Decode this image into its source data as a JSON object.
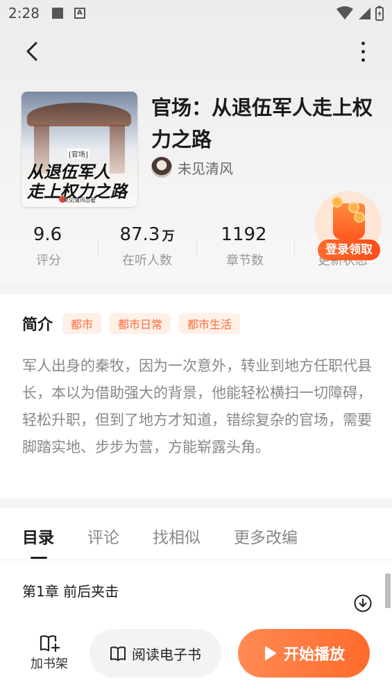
{
  "status_bar": {
    "time": "2:28"
  },
  "book": {
    "title": "官场：从退伍军人走上权力之路",
    "author": "未见清风",
    "cover": {
      "tag": "[官场]",
      "line1": "从退伍军人",
      "line2": "走上权力之路",
      "author_mark": "未见清风◎著"
    }
  },
  "stats": [
    {
      "value": "9.6",
      "unit": "",
      "label": "评分"
    },
    {
      "value": "87.3",
      "unit": "万",
      "label": "在听人数"
    },
    {
      "value": "1192",
      "unit": "",
      "label": "章节数"
    },
    {
      "value": "",
      "unit": "",
      "label": "更新状态"
    }
  ],
  "promo": {
    "label": "登录领取"
  },
  "intro": {
    "heading": "简介",
    "tags": [
      "都市",
      "都市日常",
      "都市生活"
    ],
    "text": "军人出身的秦牧，因为一次意外，转业到地方任职代县长，本以为借助强大的背景，他能轻松横扫一切障碍，轻松升职，但到了地方才知道，错综复杂的官场，需要脚踏实地、步步为营，方能崭露头角。"
  },
  "tabs": [
    "目录",
    "评论",
    "找相似",
    "更多改编"
  ],
  "active_tab": "目录",
  "chapters": [
    {
      "title": "第1章 前后夹击"
    }
  ],
  "bottom_bar": {
    "shelf_label": "加书架",
    "read_label": "阅读电子书",
    "play_label": "开始播放"
  },
  "colors": {
    "accent": "#ff6a2b",
    "tag_bg": "#fff0e8",
    "tag_text": "#ff6a3a"
  }
}
